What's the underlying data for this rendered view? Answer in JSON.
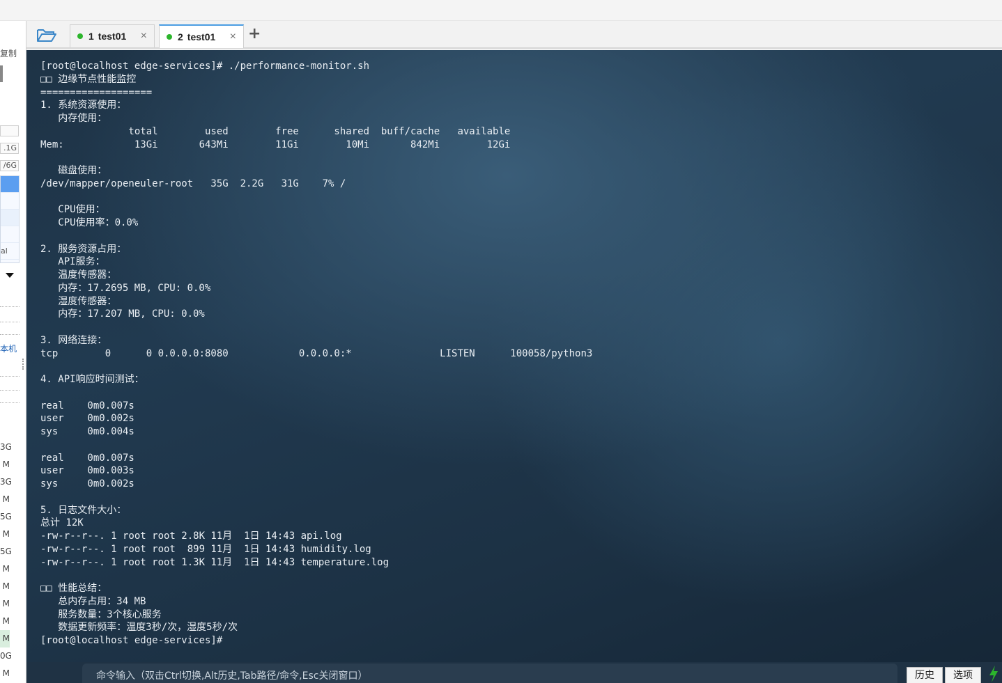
{
  "sidebar": {
    "copy_label": "复制",
    "field_1": ".1G",
    "field_2": "/6G",
    "list_tail": "al",
    "local_label": "本机",
    "sizes": [
      "3G",
      "M",
      "3G",
      "M",
      "5G",
      "M",
      "5G",
      "M",
      "M",
      "M",
      "M",
      "M",
      "0G",
      "M"
    ]
  },
  "tabs": [
    {
      "number": "1",
      "label": "test01",
      "status": "connected",
      "active": false
    },
    {
      "number": "2",
      "label": "test01",
      "status": "connected",
      "active": true
    }
  ],
  "add_tab_label": "+",
  "close_glyph": "×",
  "terminal": {
    "lines": [
      "[root@localhost edge-services]# ./performance-monitor.sh",
      "□□ 边缘节点性能监控",
      "===================",
      "1. 系统资源使用：",
      "   内存使用：",
      "               total        used        free      shared  buff/cache   available",
      "Mem:            13Gi       643Mi        11Gi        10Mi       842Mi        12Gi",
      "",
      "   磁盘使用：",
      "/dev/mapper/openeuler-root   35G  2.2G   31G    7% /",
      "",
      "   CPU使用：",
      "   CPU使用率：0.0%",
      "",
      "2. 服务资源占用：",
      "   API服务：",
      "   温度传感器：",
      "   内存：17.2695 MB, CPU: 0.0%",
      "   湿度传感器：",
      "   内存：17.207 MB, CPU: 0.0%",
      "",
      "3. 网络连接：",
      "tcp        0      0 0.0.0.0:8080            0.0.0.0:*               LISTEN      100058/python3",
      "",
      "4. API响应时间测试：",
      "",
      "real    0m0.007s",
      "user    0m0.002s",
      "sys     0m0.004s",
      "",
      "real    0m0.007s",
      "user    0m0.003s",
      "sys     0m0.002s",
      "",
      "5. 日志文件大小：",
      "总计 12K",
      "-rw-r--r--. 1 root root 2.8K 11月  1日 14:43 api.log",
      "-rw-r--r--. 1 root root  899 11月  1日 14:43 humidity.log",
      "-rw-r--r--. 1 root root 1.3K 11月  1日 14:43 temperature.log",
      "",
      "□□ 性能总结：",
      "   总内存占用：34 MB",
      "   服务数量：3个核心服务",
      "   数据更新频率：温度3秒/次，湿度5秒/次",
      "[root@localhost edge-services]#"
    ]
  },
  "command_bar": {
    "placeholder": "命令输入（双击Ctrl切换,Alt历史,Tab路径/命令,Esc关闭窗口）",
    "history_button": "历史",
    "options_button": "选项"
  },
  "colors": {
    "tab_active_accent": "#4a9de2",
    "status_dot": "#2cb52c",
    "terminal_text": "#e9eef3",
    "terminal_bg": "#1e3346",
    "bolt": "#2cb52c"
  }
}
